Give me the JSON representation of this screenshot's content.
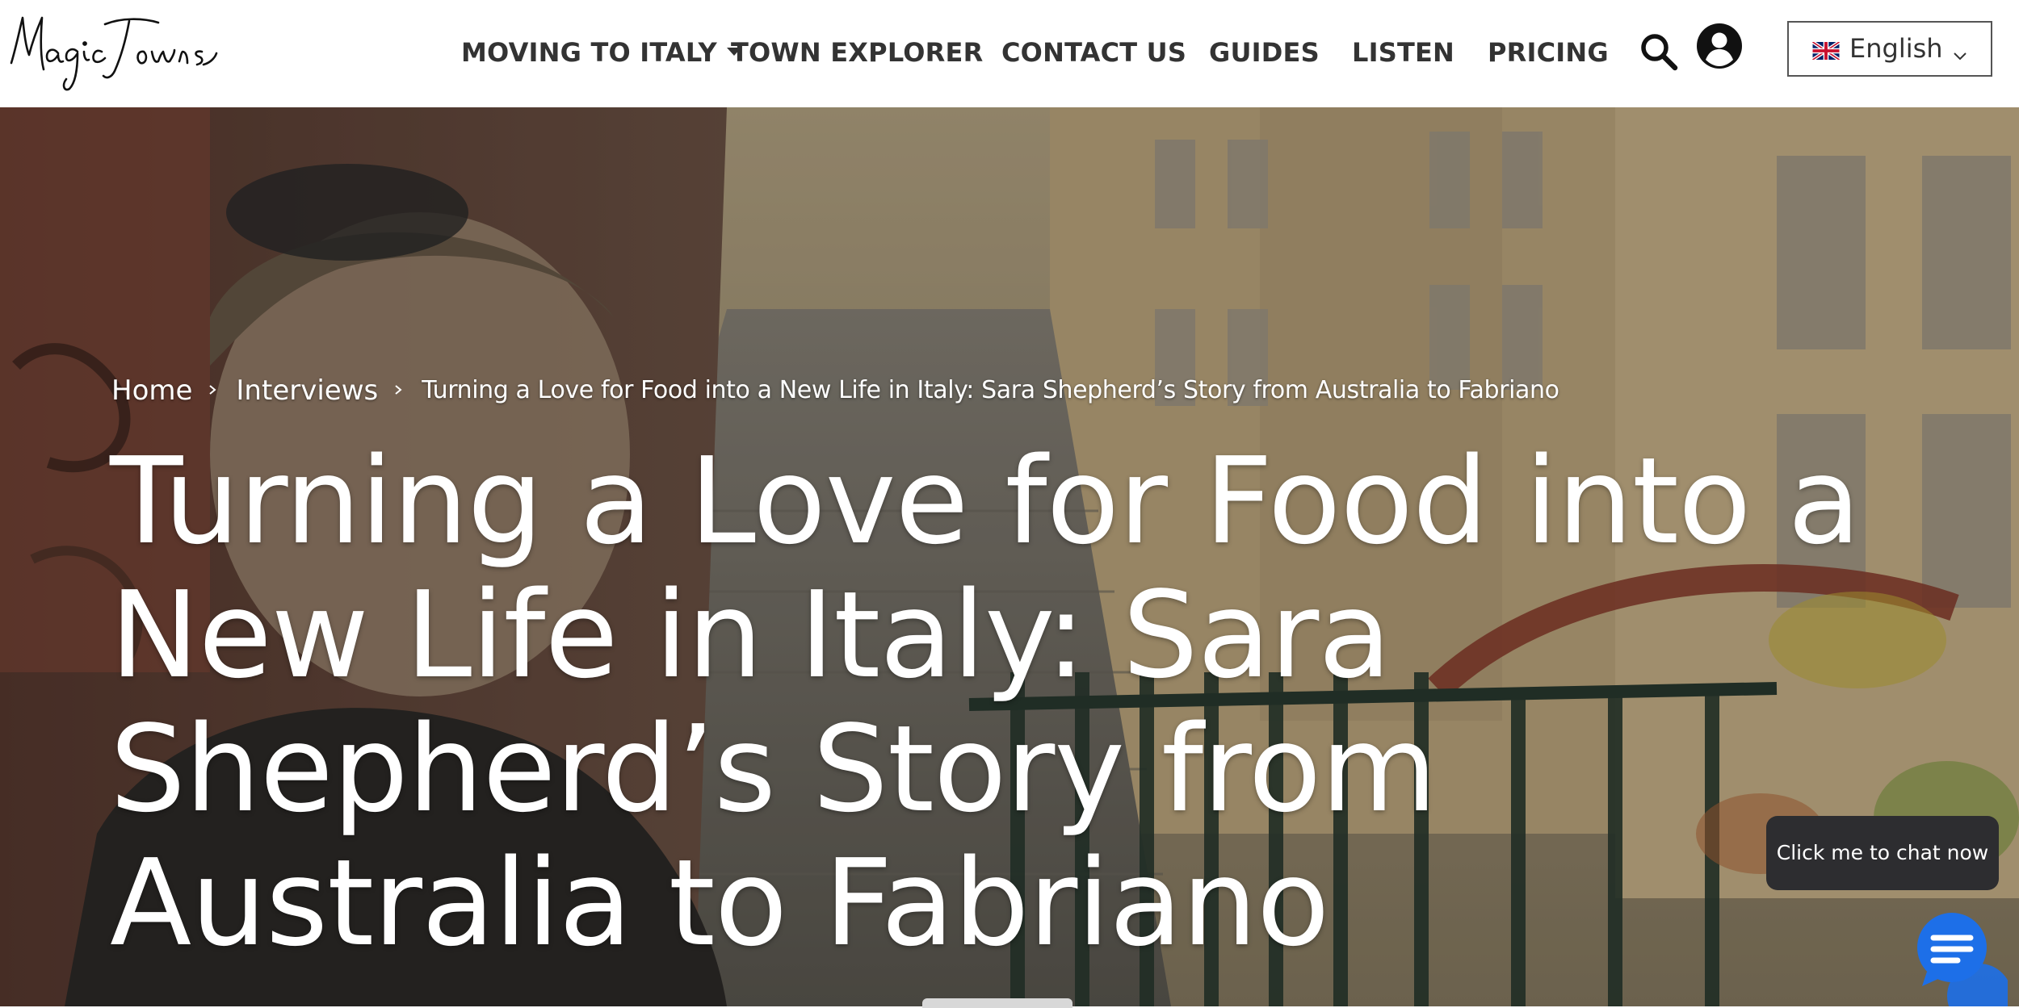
{
  "brand": {
    "logo_text": "MagicTowns"
  },
  "nav": {
    "items": [
      {
        "label": "MOVING TO ITALY",
        "has_dropdown": true
      },
      {
        "label": "TOWN EXPLORER"
      },
      {
        "label": "CONTACT US"
      },
      {
        "label": "GUIDES"
      },
      {
        "label": "LISTEN"
      },
      {
        "label": "PRICING"
      }
    ]
  },
  "header_icons": {
    "search": "search-icon",
    "account": "account-icon"
  },
  "language": {
    "selected": "English",
    "flag": "uk-flag-icon"
  },
  "breadcrumb": [
    {
      "label": "Home"
    },
    {
      "label": "Interviews"
    },
    {
      "label": "Turning a Love for Food into a New Life in Italy: Sara Shepherd’s Story from Australia to Fabriano"
    }
  ],
  "hero": {
    "title": "Turning a Love for Food into a New Life in Italy: Sara Shepherd’s Story from Australia to Fabriano"
  },
  "chat": {
    "prompt": "Click me to chat now",
    "launcher_icon": "chat-icon"
  },
  "colors": {
    "nav_text": "#333333",
    "hero_text": "#ffffff",
    "chat_bubble": "#2d2d30",
    "chat_launcher": "#1d6fe8"
  }
}
